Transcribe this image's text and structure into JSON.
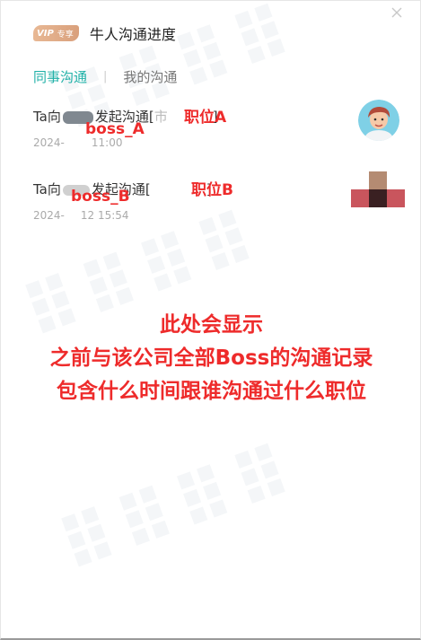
{
  "header": {
    "vip_label": "VIP",
    "vip_tag": "专享",
    "title": "牛人沟通进度",
    "close_icon": "close-icon"
  },
  "tabs": [
    {
      "label": "同事沟通",
      "active": true
    },
    {
      "label": "我的沟通",
      "active": false
    }
  ],
  "items": [
    {
      "prefix": "Ta向",
      "mid": "发起沟通[",
      "partial": "市",
      "suffix": "]",
      "time_prefix": "2024-",
      "time_suffix": "11:00",
      "boss_overlay": "boss_A",
      "job_overlay": "职位A",
      "avatar_icon": "cartoon-person-icon"
    },
    {
      "prefix": "Ta向",
      "mid": "发起沟通[",
      "partial": "",
      "suffix": "]",
      "time_prefix": "2024-",
      "time_suffix": "12 15:54",
      "boss_overlay": "boss_B",
      "job_overlay": "职位B",
      "avatar_icon": "pixelated-avatar-icon"
    }
  ],
  "annotation": {
    "line1": "此处会显示",
    "line2": "之前与该公司全部Boss的沟通记录",
    "line3": "包含什么时间跟谁沟通过什么职位"
  },
  "colors": {
    "accent": "#21b1a8",
    "annotation": "#ee2b2b",
    "vip": "#e0ab86"
  }
}
